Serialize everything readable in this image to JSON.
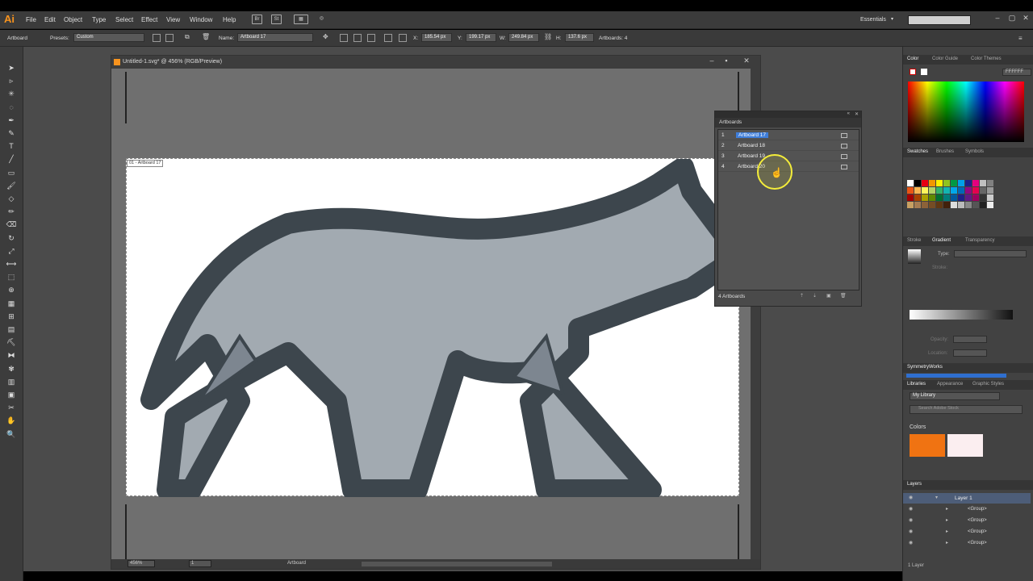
{
  "app": {
    "logo": "Ai",
    "menu": [
      "File",
      "Edit",
      "Object",
      "Type",
      "Select",
      "Effect",
      "View",
      "Window",
      "Help"
    ],
    "menu_icons": [
      "Br",
      "St"
    ],
    "workspace": "Essentials"
  },
  "controlbar": {
    "mode": "Artboard",
    "presets_label": "Presets:",
    "presets_value": "Custom",
    "name_label": "Name:",
    "name_value": "Artboard 17",
    "x_label": "X:",
    "x_value": "185.54 px",
    "y_label": "Y:",
    "y_value": "199.17 px",
    "w_label": "W:",
    "w_value": "249.84 px",
    "h_label": "H:",
    "h_value": "137.6 px",
    "artboards_label": "Artboards: 4"
  },
  "document": {
    "title": "Untitled-1.svg* @ 456% (RGB/Preview)",
    "artboard_label": "01 - Artboard 17",
    "zoom": "456%",
    "page": "1",
    "status": "Artboard"
  },
  "artboards_panel": {
    "title": "Artboards",
    "rows": [
      {
        "num": "1",
        "name": "Artboard 17"
      },
      {
        "num": "2",
        "name": "Artboard 18"
      },
      {
        "num": "3",
        "name": "Artboard 19"
      },
      {
        "num": "4",
        "name": "Artboard 20"
      }
    ],
    "footer": "4 Artboards"
  },
  "right_panels": {
    "color_tabs": [
      "Color",
      "Color Guide",
      "Color Themes"
    ],
    "hex": "FFFFFF",
    "swatch_tabs": [
      "Swatches",
      "Brushes",
      "Symbols"
    ],
    "gradient_tabs": [
      "Stroke",
      "Gradient",
      "Transparency"
    ],
    "gradient_type": "Type:",
    "gradient_stroke": "Stroke:",
    "gradient_opacity": "Opacity:",
    "gradient_location": "Location:",
    "symmetry": "SymmetryWorks",
    "library_tabs": [
      "Libraries",
      "Appearance",
      "Graphic Styles"
    ],
    "library_name": "My Library",
    "search_placeholder": "Search Adobe Stock",
    "colors_label": "Colors",
    "layers_title": "Layers",
    "layer_name": "Layer 1",
    "groups": [
      "<Group>",
      "<Group>",
      "<Group>",
      "<Group>"
    ],
    "layers_footer": "1 Layer"
  },
  "colors": {
    "wolf_body": "#a2aab1",
    "wolf_stroke": "#3d464d",
    "wolf_inner": "#7d8690",
    "lib_orange": "#f07312",
    "lib_pink": "#fbeef0",
    "accent_select": "#3f7ed9",
    "cursor_ring": "#f4ed3a"
  },
  "tool_icons": [
    "selection-tool-icon",
    "direct-selection-tool-icon",
    "magic-wand-tool-icon",
    "lasso-tool-icon",
    "pen-tool-icon",
    "curvature-tool-icon",
    "type-tool-icon",
    "line-tool-icon",
    "rectangle-tool-icon",
    "paintbrush-tool-icon",
    "shaper-tool-icon",
    "pencil-tool-icon",
    "eraser-tool-icon",
    "rotate-tool-icon",
    "scale-tool-icon",
    "width-tool-icon",
    "free-transform-tool-icon",
    "shape-builder-tool-icon",
    "perspective-grid-tool-icon",
    "mesh-tool-icon",
    "gradient-tool-icon",
    "eyedropper-tool-icon",
    "blend-tool-icon",
    "symbol-sprayer-tool-icon",
    "column-graph-tool-icon",
    "artboard-tool-icon",
    "slice-tool-icon",
    "hand-tool-icon",
    "zoom-tool-icon"
  ]
}
